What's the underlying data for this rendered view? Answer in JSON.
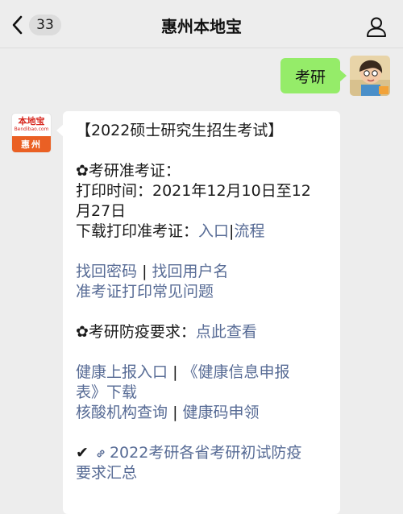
{
  "header": {
    "back_count": "33",
    "title": "惠州本地宝"
  },
  "outgoing": {
    "text": "考研"
  },
  "bot_avatar": {
    "logo_text": "本地宝",
    "logo_sub": "Bendibao.com",
    "city_text": "惠州"
  },
  "message": {
    "heading": "【2022硕士研究生招生考试】",
    "section1_title": "✿考研准考证：",
    "print_time_l1": "打印时间：2021年12月10日至12",
    "print_time_l2": "月27日",
    "download_label": "下载打印准考证：",
    "link_entry": "入口",
    "separator": "|",
    "link_flow": "流程",
    "link_retrieve_password": "找回密码",
    "link_retrieve_username": "找回用户名",
    "link_faq": "准考证打印常见问题",
    "section2_title": "✿考研防疫要求：",
    "link_click_view": "点此查看",
    "link_health_report": "健康上报入口",
    "link_health_form_l1": "《健康信息申报",
    "link_health_form_l2": "表》下载",
    "link_nucleic": "核酸机构查询",
    "link_health_code": "健康码申领",
    "check_mark": "✔",
    "link_summary_l1": "2022考研各省考研初试防疫",
    "link_summary_l2": "要求汇总"
  },
  "colors": {
    "link": "#576b95",
    "bubble_me": "#95ec69",
    "background": "#ededed"
  }
}
